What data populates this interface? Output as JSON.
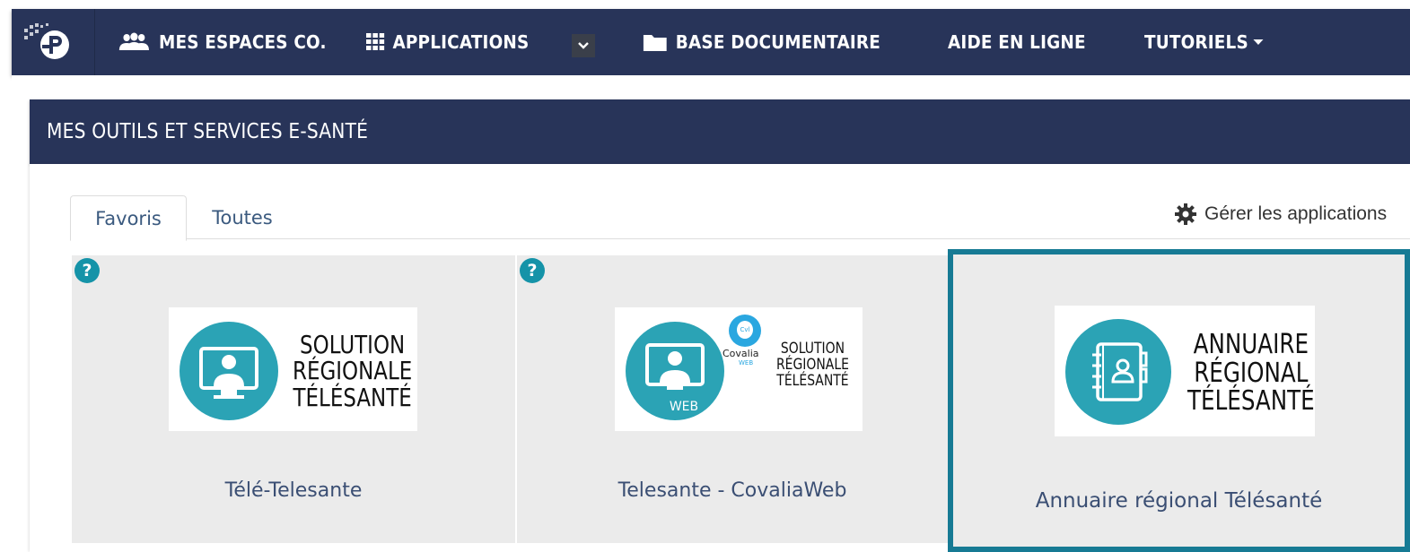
{
  "navbar": {
    "items": [
      {
        "label": "MES ESPACES CO.",
        "icon": "users-icon"
      },
      {
        "label": "APPLICATIONS",
        "icon": "grid-icon"
      },
      {
        "label": "BASE DOCUMENTAIRE",
        "icon": "folder-icon"
      },
      {
        "label": "AIDE EN LIGNE"
      },
      {
        "label": "TUTORIELS",
        "icon": "caret-down-icon"
      }
    ],
    "applications_dropdown_icon": "chevron-down-icon",
    "logo_icon": "app-logo-icon"
  },
  "panel": {
    "title": "MES OUTILS ET SERVICES E-SANTÉ"
  },
  "tabs": [
    {
      "label": "Favoris",
      "active": true
    },
    {
      "label": "Toutes",
      "active": false
    }
  ],
  "manage": {
    "label": "Gérer les applications",
    "icon": "gear-icon"
  },
  "cards": [
    {
      "name": "Télé-Telesante",
      "help": "?",
      "logo_lines": [
        "SOLUTION",
        "RÉGIONALE",
        "TÉLÉSANTÉ"
      ],
      "selected": false
    },
    {
      "name": "Telesante - CovaliaWeb",
      "help": "?",
      "logo_lines": [
        "SOLUTION",
        "RÉGIONALE",
        "TÉLÉSANTÉ"
      ],
      "logo_badge": "WEB",
      "logo_brand": "Covalia",
      "logo_brand_sub": "WEB",
      "logo_brand_mark": "Cvl",
      "selected": false
    },
    {
      "name": "Annuaire régional Télésanté",
      "logo_lines": [
        "ANNUAIRE",
        "RÉGIONAL",
        "TÉLÉSANTÉ"
      ],
      "selected": true
    }
  ],
  "colors": {
    "navbar": "#283459",
    "accent_teal": "#2ba3b5",
    "help_badge": "#1593a8",
    "selected_border": "#167a94",
    "card_bg": "#ebebeb"
  }
}
